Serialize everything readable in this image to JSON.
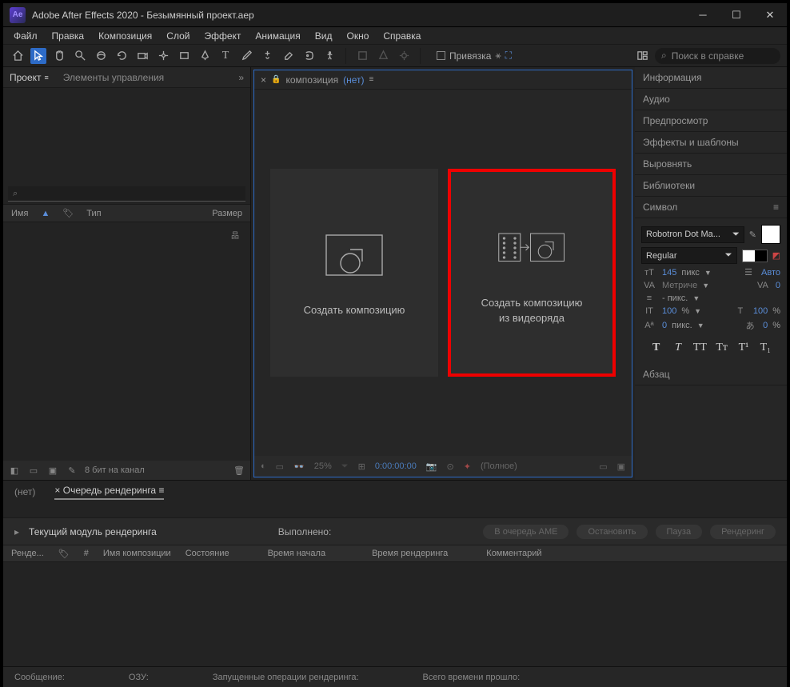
{
  "title": "Adobe After Effects 2020 - Безымянный проект.aep",
  "logo": "Ae",
  "menu": [
    "Файл",
    "Правка",
    "Композиция",
    "Слой",
    "Эффект",
    "Анимация",
    "Вид",
    "Окно",
    "Справка"
  ],
  "toolbar": {
    "snap": "Привязка",
    "search_placeholder": "Поиск в справке"
  },
  "left": {
    "tab_project": "Проект",
    "tab_controls": "Элементы управления",
    "search_placeholder": "⌕",
    "col_name": "Имя",
    "col_type": "Тип",
    "col_size": "Размер",
    "bpc": "8 бит на канал"
  },
  "center": {
    "tab_prefix": "композиция",
    "tab_none": "(нет)",
    "card1": "Создать композицию",
    "card2_line1": "Создать композицию",
    "card2_line2": "из видеоряда",
    "zoom": "25%",
    "time": "0:00:00:00",
    "res": "(Полное)"
  },
  "right": {
    "sections": [
      "Информация",
      "Аудио",
      "Предпросмотр",
      "Эффекты и шаблоны",
      "Выровнять",
      "Библиотеки",
      "Символ"
    ],
    "font": "Robotron Dot Ma...",
    "weight": "Regular",
    "size": "145",
    "size_unit": "пикс",
    "leading": "Авто",
    "kerning": "Метриче",
    "tracking": "0",
    "stroke": "- пикс.",
    "hscale": "100",
    "vscale": "100",
    "baseline": "0",
    "tsume": "0",
    "percent": "%",
    "px": "пикс.",
    "paragraph": "Абзац"
  },
  "timeline": {
    "tab_none": "(нет)",
    "tab_render": "Очередь рендеринга",
    "module": "Текущий модуль рендеринга",
    "done": "Выполнено:",
    "btn_ame": "В очередь AME",
    "btn_stop": "Остановить",
    "btn_pause": "Пауза",
    "btn_render": "Рендеринг",
    "cols": [
      "Ренде...",
      "#",
      "Имя композиции",
      "Состояние",
      "Время начала",
      "Время рендеринга",
      "Комментарий"
    ]
  },
  "status": {
    "msg": "Сообщение:",
    "ram": "ОЗУ:",
    "ops": "Запущенные операции рендеринга:",
    "time": "Всего времени прошло:"
  }
}
